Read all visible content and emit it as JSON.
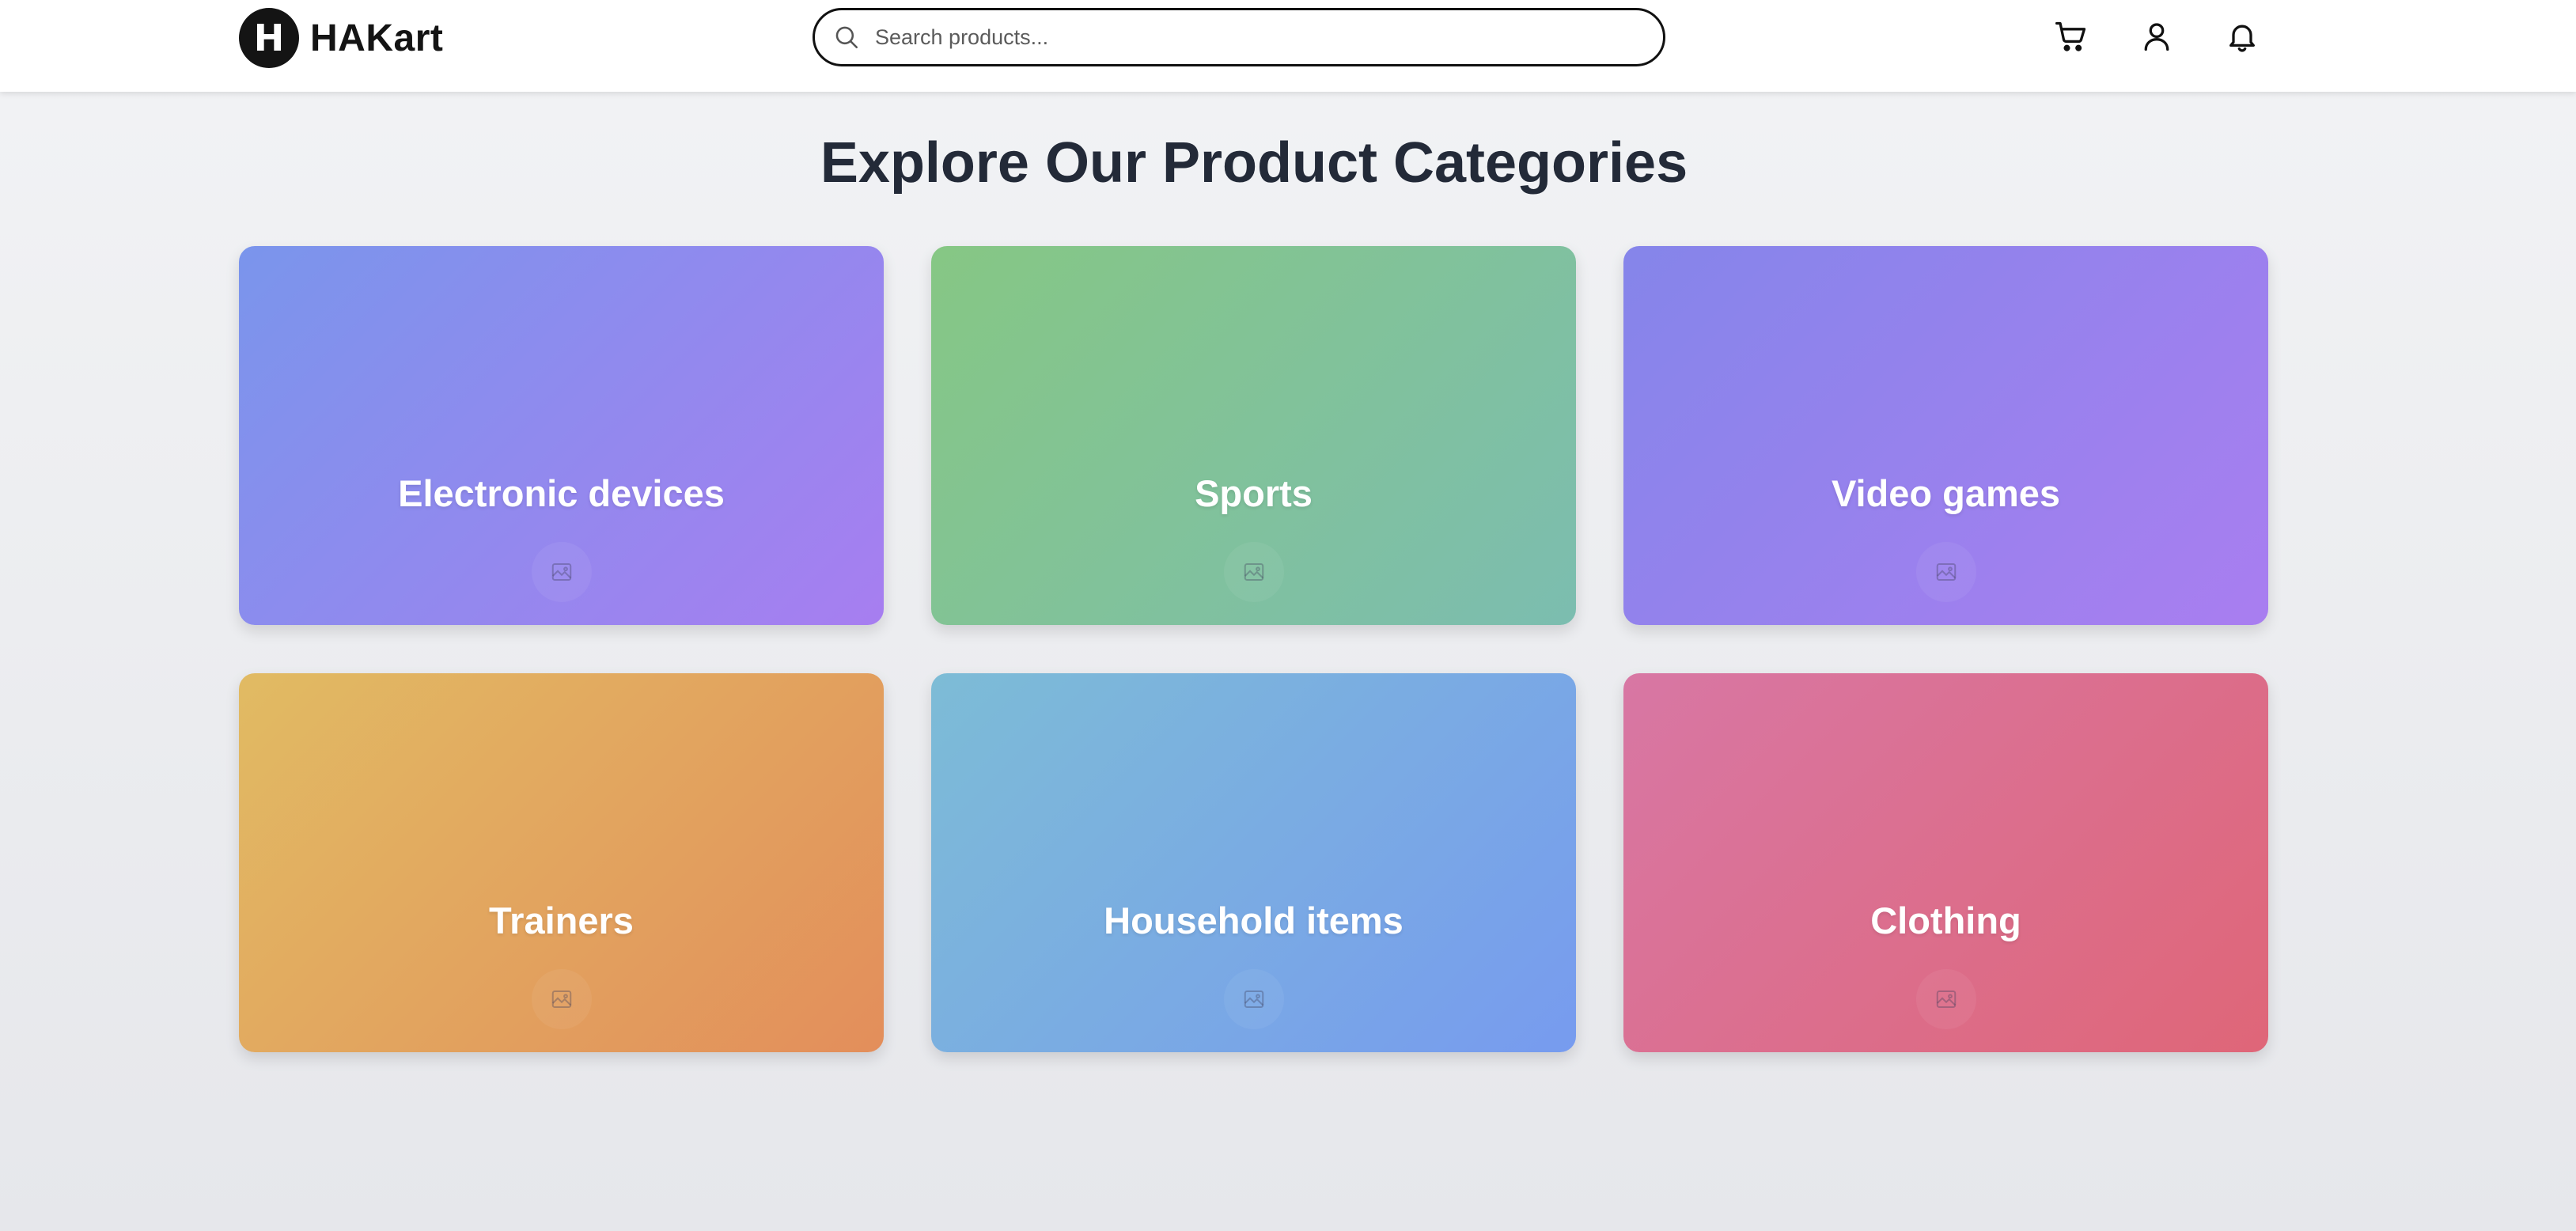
{
  "header": {
    "logo_letter": "H",
    "brand_name": "HAKart",
    "search_placeholder": "Search products..."
  },
  "nav": {
    "icons": [
      "cart-icon",
      "user-icon",
      "bell-icon"
    ]
  },
  "main": {
    "title": "Explore Our Product Categories",
    "categories": [
      {
        "label": "Electronic devices",
        "gradient": [
          "#7a95ec",
          "#a77ef0"
        ]
      },
      {
        "label": "Sports",
        "gradient": [
          "#86c784",
          "#7cbdb0"
        ]
      },
      {
        "label": "Video games",
        "gradient": [
          "#8585ea",
          "#a97ef0"
        ]
      },
      {
        "label": "Trainers",
        "gradient": [
          "#e1bb63",
          "#e38e5b"
        ]
      },
      {
        "label": "Household items",
        "gradient": [
          "#7dbcd6",
          "#779bef"
        ]
      },
      {
        "label": "Clothing",
        "gradient": [
          "#d877a4",
          "#df6678"
        ]
      }
    ]
  },
  "colors": {
    "brand_dark": "#141414",
    "title_text": "#232a38",
    "page_background": "#eeeff2"
  }
}
